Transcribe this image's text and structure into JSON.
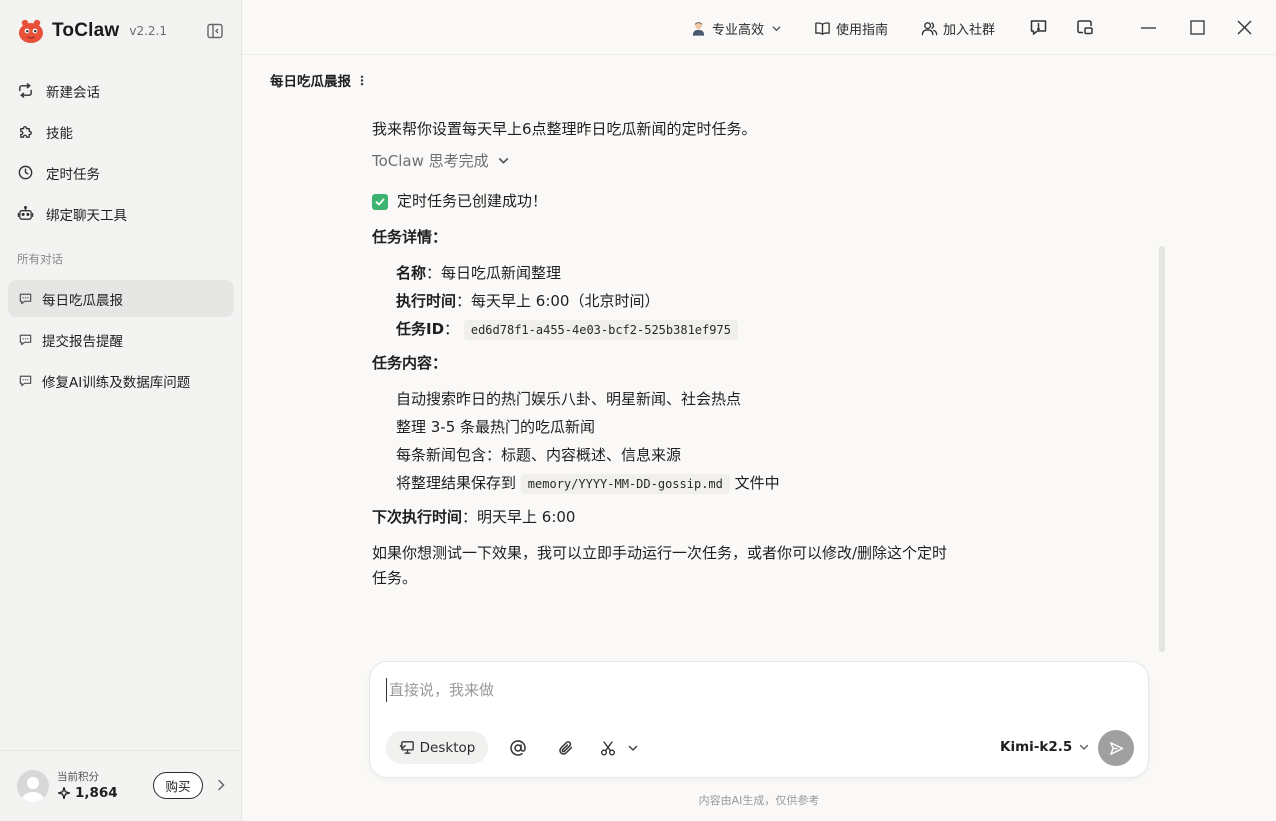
{
  "app": {
    "name": "ToClaw",
    "version": "v2.2.1"
  },
  "nav": [
    {
      "label": "新建会话",
      "icon": "new-chat-icon"
    },
    {
      "label": "技能",
      "icon": "puzzle-icon"
    },
    {
      "label": "定时任务",
      "icon": "clock-icon"
    },
    {
      "label": "绑定聊天工具",
      "icon": "robot-icon"
    }
  ],
  "section_label": "所有对话",
  "conversations": [
    {
      "label": "每日吃瓜晨报",
      "active": true
    },
    {
      "label": "提交报告提醒",
      "active": false
    },
    {
      "label": "修复AI训练及数据库问题",
      "active": false
    }
  ],
  "footer": {
    "points_label": "当前积分",
    "points_value": "1,864",
    "buy_label": "购买"
  },
  "topbar": {
    "mode": "专业高效",
    "guide": "使用指南",
    "community": "加入社群"
  },
  "conversation_title": "每日吃瓜晨报",
  "message": {
    "intro": "我来帮你设置每天早上6点整理昨日吃瓜新闻的定时任务。",
    "thinking": "ToClaw 思考完成",
    "success": "定时任务已创建成功！",
    "details_heading": "任务详情：",
    "name_label": "名称",
    "name_value": "：每日吃瓜新闻整理",
    "time_label": "执行时间",
    "time_value": "：每天早上 6:00（北京时间）",
    "id_label": "任务ID",
    "id_sep": "：",
    "id_value": "ed6d78f1-a455-4e03-bcf2-525b381ef975",
    "content_heading": "任务内容：",
    "content_1": "自动搜索昨日的热门娱乐八卦、明星新闻、社会热点",
    "content_2": "整理 3-5 条最热门的吃瓜新闻",
    "content_3": "每条新闻包含：标题、内容概述、信息来源",
    "content_4_pre": "将整理结果保存到",
    "content_4_code": "memory/YYYY-MM-DD-gossip.md",
    "content_4_post": "文件中",
    "next_label": "下次执行时间",
    "next_value": "：明天早上 6:00",
    "closing_1": "如果你想测试一下效果，我可以立即手动运行一次任务，或者你可以修改/删除这个定时",
    "closing_2": "任务。"
  },
  "composer": {
    "placeholder": "直接说，我来做",
    "desktop_label": "Desktop",
    "model": "Kimi-k2.5"
  },
  "disclaimer": "内容由AI生成，仅供参考",
  "colors": {
    "accent_logo": "#e8503a",
    "check": "#3cb371",
    "send": "#a0a0a0"
  }
}
